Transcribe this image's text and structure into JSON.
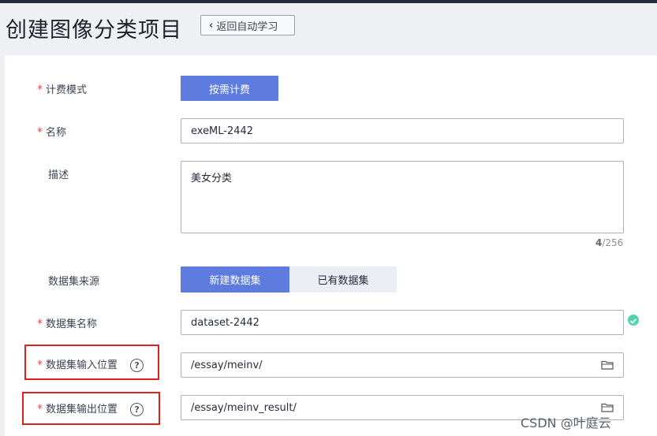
{
  "header": {
    "title": "创建图像分类项目",
    "back_label": "返回自动学习"
  },
  "form": {
    "billing": {
      "label": "计费模式",
      "button": "按需计费"
    },
    "name": {
      "label": "名称",
      "value": "exeML-2442"
    },
    "description": {
      "label": "描述",
      "value": "美女分类",
      "count": "4",
      "max": "/256"
    },
    "dataset_source": {
      "label": "数据集来源",
      "options": [
        "新建数据集",
        "已有数据集"
      ],
      "selected": "新建数据集"
    },
    "dataset_name": {
      "label": "数据集名称",
      "value": "dataset-2442"
    },
    "input_location": {
      "label": "数据集输入位置",
      "value": "/essay/meinv/"
    },
    "output_location": {
      "label": "数据集输出位置",
      "value": "/essay/meinv_result/"
    }
  },
  "required_mark": "*",
  "help_mark": "?",
  "watermark": "CSDN @叶庭云",
  "colors": {
    "primary": "#5e7ce0",
    "required": "#e5484d",
    "highlight_box": "#e02020",
    "success": "#50d4ab"
  }
}
